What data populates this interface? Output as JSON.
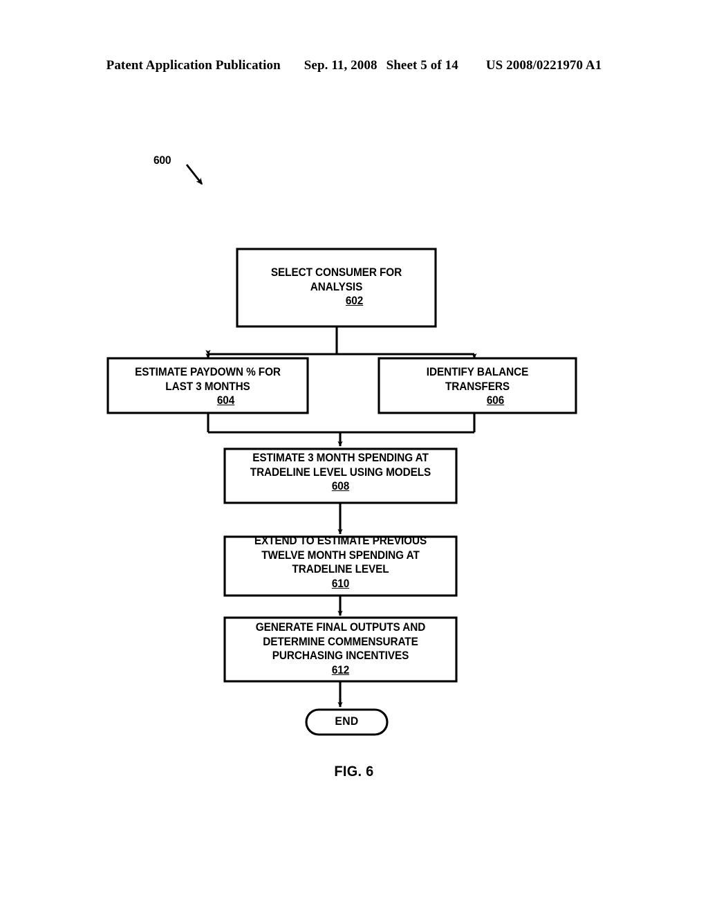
{
  "header": {
    "publication": "Patent Application Publication",
    "date": "Sep. 11, 2008",
    "sheet": "Sheet 5 of 14",
    "patent_number": "US 2008/0221970 A1"
  },
  "figure": {
    "caption": "FIG. 6",
    "flow_reference": "600",
    "nodes": [
      {
        "id": "602",
        "shape": "rectangle",
        "lines": [
          "SELECT CONSUMER FOR",
          "ANALYSIS"
        ],
        "reference": "602"
      },
      {
        "id": "604",
        "shape": "rectangle",
        "lines": [
          "ESTIMATE PAYDOWN % FOR",
          "LAST 3 MONTHS"
        ],
        "reference": "604"
      },
      {
        "id": "606",
        "shape": "rectangle",
        "lines": [
          "IDENTIFY BALANCE",
          "TRANSFERS"
        ],
        "reference": "606"
      },
      {
        "id": "608",
        "shape": "rectangle",
        "lines": [
          "ESTIMATE 3 MONTH SPENDING AT",
          "TRADELINE LEVEL USING MODELS"
        ],
        "reference": "608"
      },
      {
        "id": "610",
        "shape": "rectangle",
        "lines": [
          "EXTEND TO ESTIMATE PREVIOUS",
          "TWELVE MONTH SPENDING AT",
          "TRADELINE LEVEL"
        ],
        "reference": "610"
      },
      {
        "id": "612",
        "shape": "rectangle",
        "lines": [
          "GENERATE FINAL OUTPUTS AND",
          "DETERMINE COMMENSURATE",
          "PURCHASING INCENTIVES"
        ],
        "reference": "612"
      },
      {
        "id": "end",
        "shape": "stadium",
        "lines": [
          "END"
        ],
        "reference": ""
      }
    ],
    "edges": [
      {
        "from": "602",
        "to": "604",
        "type": "split-branch"
      },
      {
        "from": "602",
        "to": "606",
        "type": "split-branch"
      },
      {
        "from": "604",
        "to": "608",
        "type": "merge-branch"
      },
      {
        "from": "606",
        "to": "608",
        "type": "merge-branch"
      },
      {
        "from": "608",
        "to": "610",
        "type": "straight"
      },
      {
        "from": "610",
        "to": "612",
        "type": "straight"
      },
      {
        "from": "612",
        "to": "end",
        "type": "straight"
      }
    ]
  },
  "colors": {
    "ink": "#000000",
    "paper": "#ffffff"
  }
}
